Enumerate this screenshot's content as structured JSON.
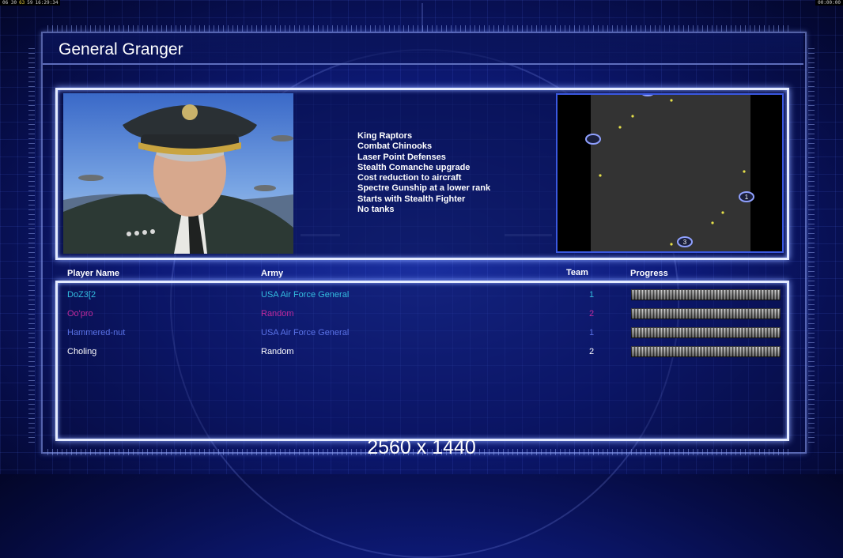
{
  "status_bar": {
    "left_time": "06 30",
    "fps": "63",
    "extra": "59",
    "clock": "16:29:34",
    "right_time": "00:00:00"
  },
  "general": {
    "name": "General Granger",
    "perks": [
      "King Raptors",
      "Combat Chinooks",
      "Laser Point Defenses",
      "Stealth Comanche upgrade",
      "Cost reduction to aircraft",
      "Spectre Gunship at a lower rank",
      "Starts with Stealth Fighter",
      "No tanks"
    ]
  },
  "map": {
    "start_positions": [
      {
        "label": ""
      },
      {
        "label": ""
      },
      {
        "label": "1"
      },
      {
        "label": "3"
      }
    ]
  },
  "table": {
    "headers": {
      "player": "Player Name",
      "army": "Army",
      "team": "Team",
      "progress": "Progress"
    },
    "rows": [
      {
        "name": "DoZ3[2",
        "army": "USA Air Force General",
        "team": "1",
        "color": "#33bde0",
        "progress": 1
      },
      {
        "name": "Oo'pro",
        "army": "Random",
        "team": "2",
        "color": "#c02a9c",
        "progress": 1
      },
      {
        "name": "Hammered-nut",
        "army": "USA Air Force General",
        "team": "1",
        "color": "#5a72e6",
        "progress": 1
      },
      {
        "name": "Choling",
        "army": "Random",
        "team": "2",
        "color": "#ffffff",
        "progress": 1
      }
    ]
  },
  "resolution_label": "2560 x 1440"
}
